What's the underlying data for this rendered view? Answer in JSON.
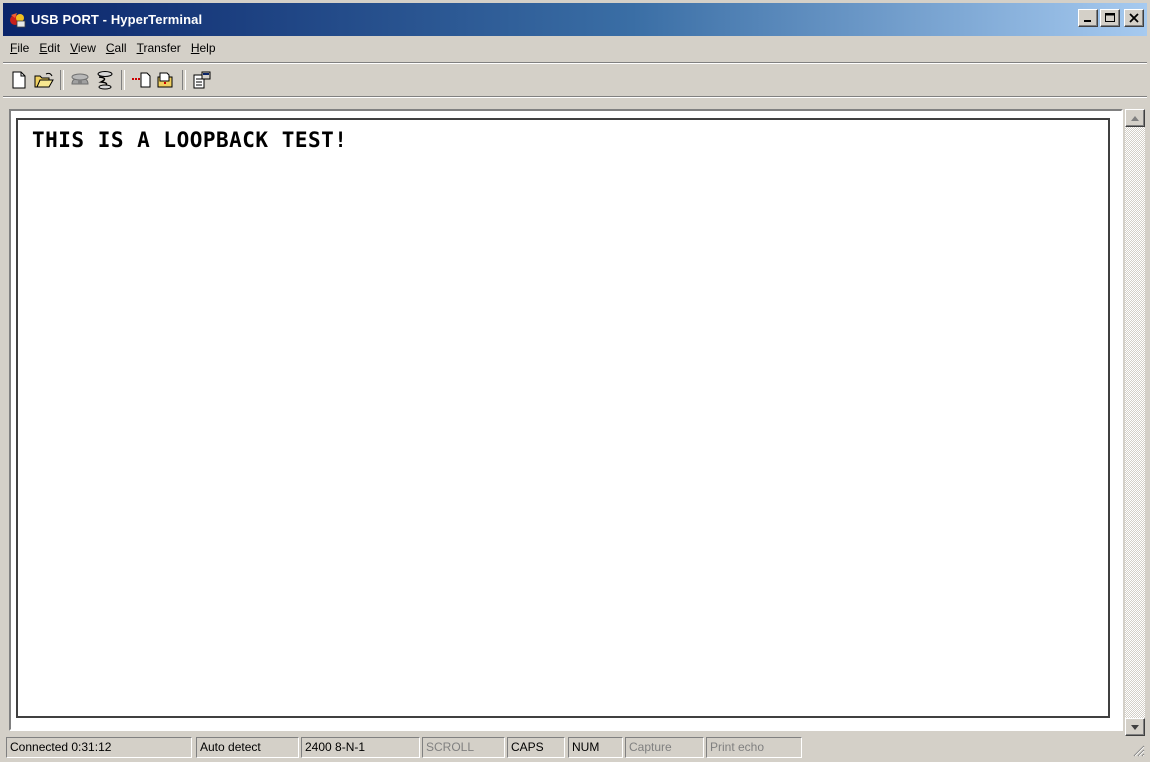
{
  "window": {
    "title": "USB PORT - HyperTerminal"
  },
  "menu": [
    {
      "id": "file",
      "mnemonic": "F",
      "rest": "ile"
    },
    {
      "id": "edit",
      "mnemonic": "E",
      "rest": "dit"
    },
    {
      "id": "view",
      "mnemonic": "V",
      "rest": "iew"
    },
    {
      "id": "call",
      "mnemonic": "C",
      "rest": "all"
    },
    {
      "id": "transfer",
      "mnemonic": "T",
      "rest": "ransfer"
    },
    {
      "id": "help",
      "mnemonic": "H",
      "rest": "elp"
    }
  ],
  "toolbar": {
    "icons": [
      "new-connection-icon",
      "open-icon",
      "disconnect-icon",
      "dial-icon",
      "send-icon",
      "receive-icon",
      "properties-icon"
    ]
  },
  "terminal": {
    "text": "THIS IS A LOOPBACK TEST!"
  },
  "statusbar": {
    "connection": "Connected 0:31:12",
    "terminal_type": "Auto detect",
    "port_settings": "2400 8-N-1",
    "scroll": "SCROLL",
    "caps": "CAPS",
    "num": "NUM",
    "capture": "Capture",
    "print_echo": "Print echo"
  },
  "colors": {
    "title_gradient_start": "#0a246a",
    "title_gradient_end": "#a6caf0",
    "face": "#d4d0c8"
  }
}
